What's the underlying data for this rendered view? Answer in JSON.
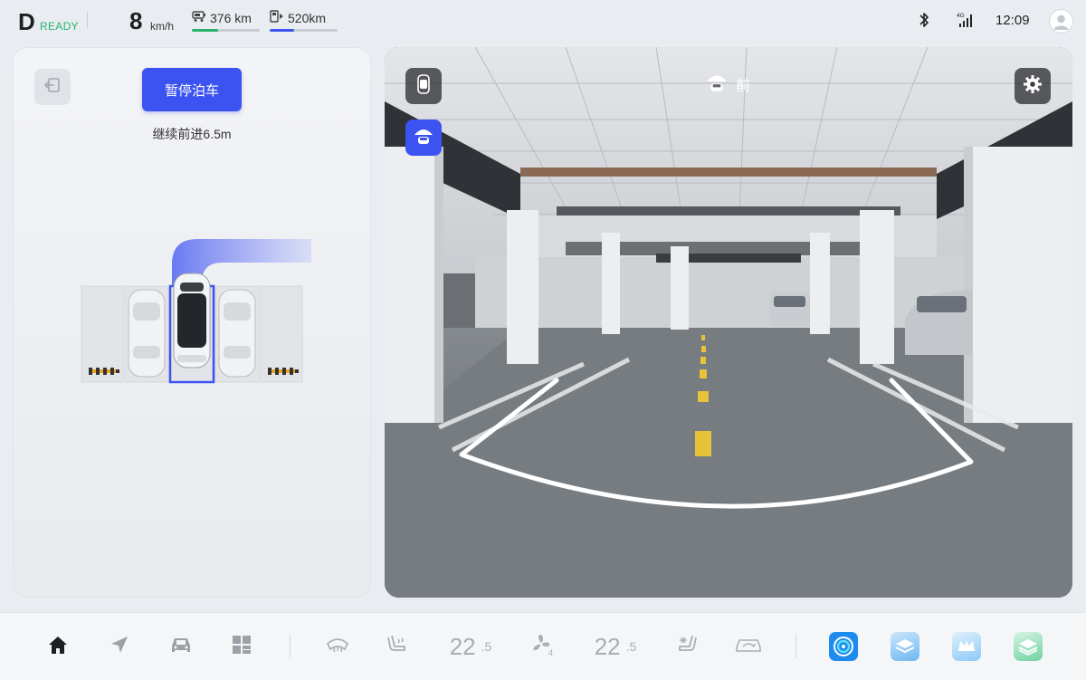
{
  "status": {
    "gear": "D",
    "gear_state": "READY",
    "speed": "8",
    "speed_unit": "km/h",
    "battery_range": "376",
    "battery_unit": "km",
    "battery_level": 0.38,
    "fuel_range": "520",
    "fuel_unit": "km",
    "fuel_level": 0.36,
    "network": "4G",
    "time": "12:09"
  },
  "parking": {
    "pause_label": "暂停泊车",
    "guidance": "继续前进6.5m"
  },
  "camera": {
    "view_label": "前"
  },
  "climate": {
    "left_temp": "22",
    "left_temp_decimal": ".5",
    "fan_level": "4",
    "right_temp": "22",
    "right_temp_decimal": ".5"
  },
  "colors": {
    "accent": "#3b53f0",
    "ready": "#26b36a",
    "battery_bar": "#26b36a",
    "fuel_bar": "#3b53f0"
  },
  "icons": {
    "status": [
      "battery-car-icon",
      "fuel-pump-icon",
      "bluetooth-icon",
      "signal-icon",
      "avatar-icon"
    ],
    "dock": [
      "home-icon",
      "navigation-icon",
      "car-icon",
      "apps-icon",
      "rear-defrost-icon",
      "seat-heat-icon",
      "fan-icon",
      "seat-ventilation-icon",
      "recirculation-icon",
      "parking-app-icon",
      "layers-app-icon",
      "crown-app-icon",
      "stack-app-icon"
    ]
  }
}
